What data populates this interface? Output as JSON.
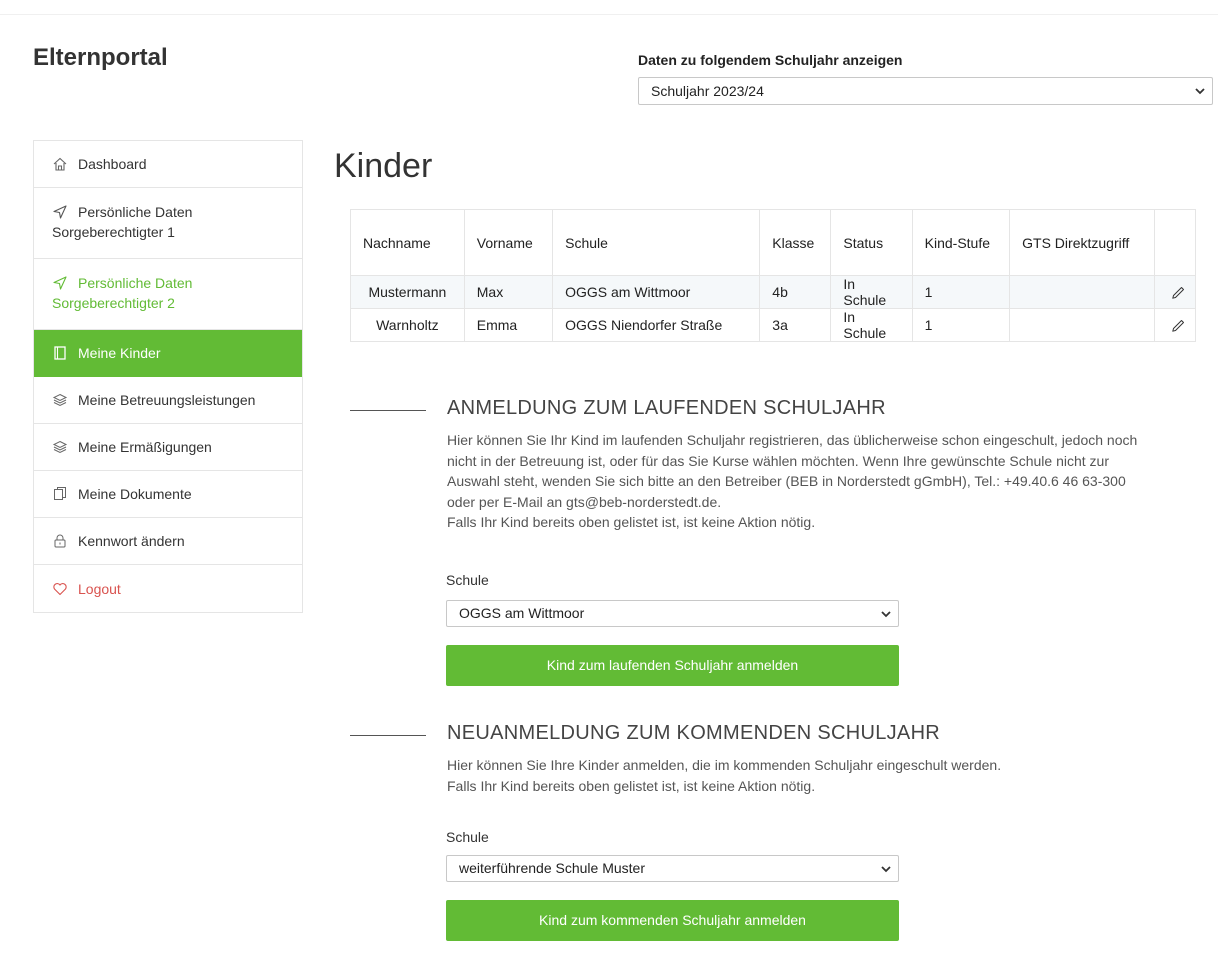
{
  "brand": "Elternportal",
  "year_selector": {
    "label": "Daten zu folgendem Schuljahr anzeigen",
    "value": "Schuljahr 2023/24"
  },
  "sidebar": {
    "items": [
      {
        "label": "Dashboard",
        "icon": "home-icon"
      },
      {
        "label_line1": "Persönliche Daten",
        "label_line2": "Sorgeberechtigter 1",
        "icon": "send-icon"
      },
      {
        "label_line1": "Persönliche Daten",
        "label_line2": "Sorgeberechtigter 2",
        "icon": "send-icon"
      },
      {
        "label": "Meine Kinder",
        "icon": "book-icon"
      },
      {
        "label": "Meine Betreuungsleistungen",
        "icon": "layers-icon"
      },
      {
        "label": "Meine Ermäßigungen",
        "icon": "layers-icon"
      },
      {
        "label": "Meine Dokumente",
        "icon": "documents-icon"
      },
      {
        "label": "Kennwort ändern",
        "icon": "lock-icon"
      },
      {
        "label": "Logout",
        "icon": "heart-icon"
      }
    ]
  },
  "page_title": "Kinder",
  "table": {
    "headers": [
      "Nachname",
      "Vorname",
      "Schule",
      "Klasse",
      "Status",
      "Kind-Stufe",
      "GTS Direktzugriff",
      ""
    ],
    "rows": [
      [
        "Mustermann",
        "Max",
        "OGGS am Wittmoor",
        "4b",
        "In Schule",
        "1",
        ""
      ],
      [
        "Warnholtz",
        "Emma",
        "OGGS Niendorfer Straße",
        "3a",
        "In Schule",
        "1",
        ""
      ]
    ]
  },
  "section_current": {
    "heading": "ANMELDUNG ZUM LAUFENDEN SCHULJAHR",
    "text_lines": [
      "Hier können Sie Ihr Kind im laufenden Schuljahr registrieren, das üblicherweise schon eingeschult, jedoch noch",
      "nicht in der Betreuung ist, oder für das Sie Kurse wählen möchten. Wenn Ihre gewünschte Schule nicht zur",
      "Auswahl steht, wenden Sie sich bitte an den Betreiber (BEB in Norderstedt gGmbH), Tel.: +49.40.6 46 63-300",
      "oder per E-Mail an gts@beb-norderstedt.de.",
      "Falls Ihr Kind bereits oben gelistet ist, ist keine Aktion nötig."
    ],
    "school_label": "Schule",
    "school_value": "OGGS am Wittmoor",
    "button": "Kind zum laufenden Schuljahr anmelden"
  },
  "section_next": {
    "heading": "NEUANMELDUNG ZUM KOMMENDEN SCHULJAHR",
    "text_lines": [
      "Hier können Sie Ihre Kinder anmelden, die im kommenden Schuljahr eingeschult werden.",
      "Falls Ihr Kind bereits oben gelistet ist, ist keine Aktion nötig."
    ],
    "school_label": "Schule",
    "school_value": "weiterführende Schule Muster",
    "button": "Kind zum kommenden Schuljahr anmelden"
  },
  "colors": {
    "accent": "#62bb35",
    "logout": "#d9534f"
  }
}
